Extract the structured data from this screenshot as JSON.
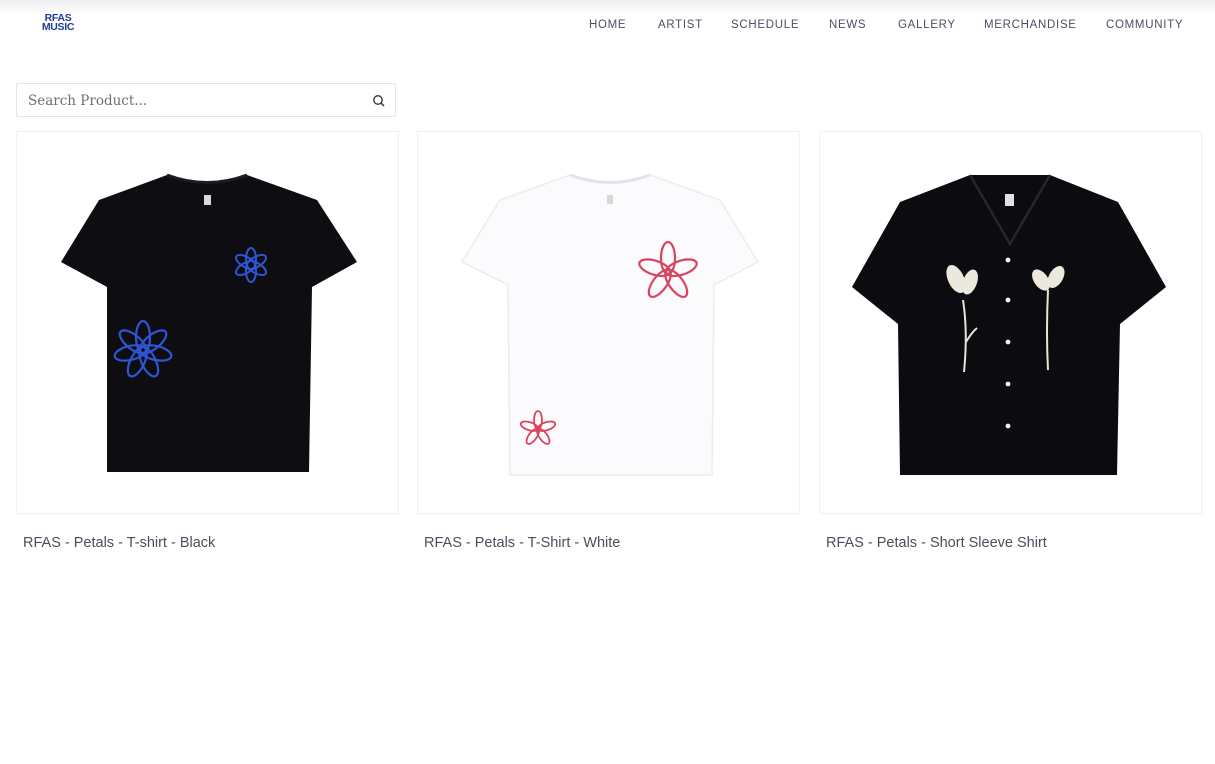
{
  "logo": {
    "line1": "RFAS",
    "line2": "MUSIC"
  },
  "nav": [
    "HOME",
    "ARTIST",
    "SCHEDULE",
    "NEWS",
    "GALLERY",
    "MERCHANDISE",
    "COMMUNITY"
  ],
  "search": {
    "placeholder": "Search Product...",
    "icon": "search-icon"
  },
  "products": [
    {
      "title": "RFAS - Petals - T-shirt - Black",
      "image": "black-tshirt-blue-flowers"
    },
    {
      "title": "RFAS - Petals - T-Shirt - White",
      "image": "white-tshirt-pink-flowers"
    },
    {
      "title": "RFAS - Petals - Short Sleeve Shirt",
      "image": "black-shirt-white-flowers"
    }
  ],
  "colors": {
    "brand": "#1f3c98",
    "nav_text": "#4a5063",
    "product_text": "#4b4f5c"
  }
}
